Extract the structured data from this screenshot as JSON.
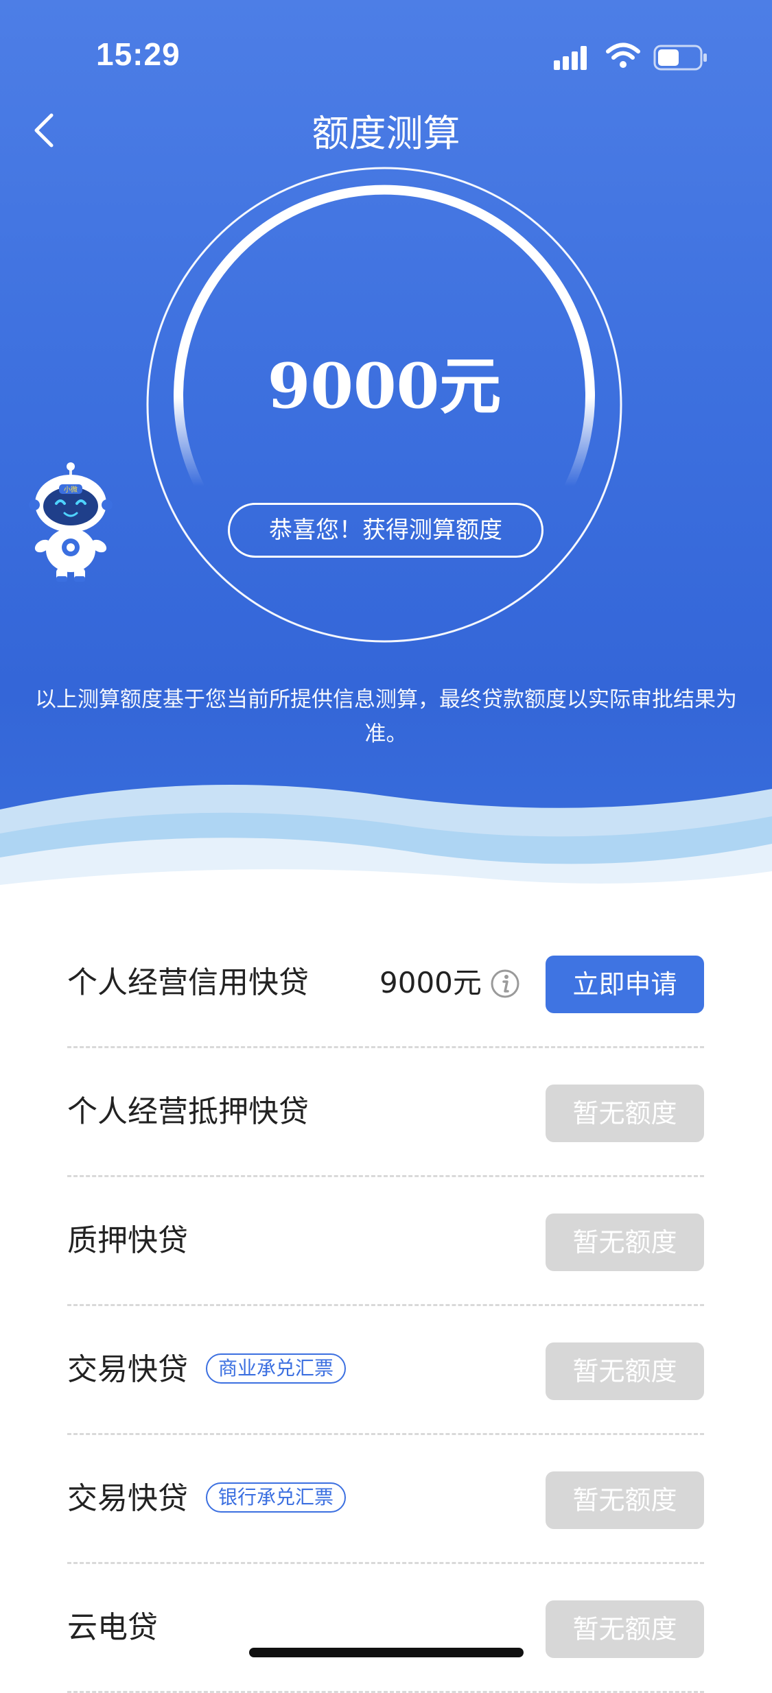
{
  "status": {
    "time": "15:29"
  },
  "nav": {
    "title": "额度测算"
  },
  "result": {
    "amount": "9000元",
    "congrats": "恭喜您！获得测算额度",
    "progress": 0.8
  },
  "mascot": {
    "badge": "小微"
  },
  "disclaimer": "以上测算额度基于您当前所提供信息测算，最终贷款额度以实际审批结果为准。",
  "products": [
    {
      "name": "个人经营信用快贷",
      "tag": "",
      "amount": "9000元",
      "action": "立即申请",
      "available": true
    },
    {
      "name": "个人经营抵押快贷",
      "tag": "",
      "amount": "",
      "action": "暂无额度",
      "available": false
    },
    {
      "name": "质押快贷",
      "tag": "",
      "amount": "",
      "action": "暂无额度",
      "available": false
    },
    {
      "name": "交易快贷",
      "tag": "商业承兑汇票",
      "amount": "",
      "action": "暂无额度",
      "available": false
    },
    {
      "name": "交易快贷",
      "tag": "银行承兑汇票",
      "amount": "",
      "action": "暂无额度",
      "available": false
    },
    {
      "name": "云电贷",
      "tag": "",
      "amount": "",
      "action": "暂无额度",
      "available": false
    }
  ],
  "colors": {
    "primary": "#3f74e2",
    "disabled": "#d7d7d7",
    "tag": "#3b6fe0",
    "hero_top": "#4d7ee6",
    "hero_bottom": "#3466d8"
  }
}
